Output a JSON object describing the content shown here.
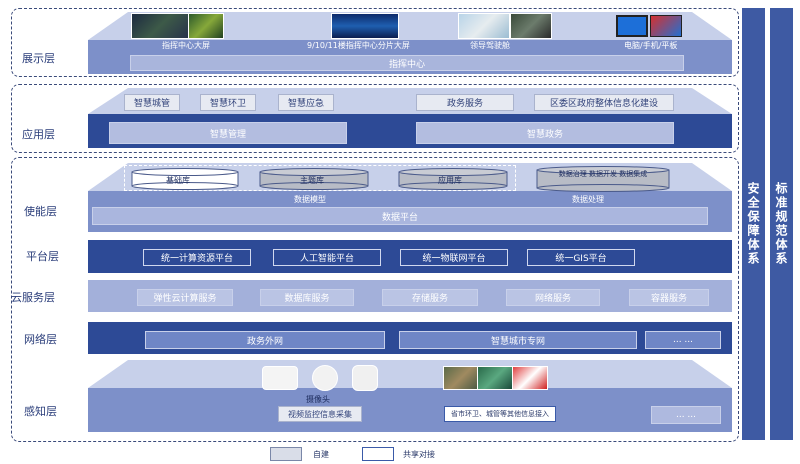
{
  "layers": {
    "display": "展示层",
    "application": "应用层",
    "enablement": "使能层",
    "platform": "平台层",
    "cloud": "云服务层",
    "network": "网络层",
    "perception": "感知层"
  },
  "display": {
    "captions": [
      "指挥中心大屏",
      "9/10/11楼指挥中心分片大屏",
      "领导驾驶舱",
      "电脑/手机/平板"
    ],
    "center": "指挥中心"
  },
  "application": {
    "top_items": [
      "智慧城管",
      "智慧环卫",
      "智慧应急",
      "政务服务",
      "区委区政府整体信息化建设"
    ],
    "bottom_items": [
      "智慧管理",
      "智慧政务"
    ]
  },
  "enablement": {
    "cylinders": [
      "基础库",
      "主题库",
      "应用库",
      "数据治理 数据开发 数据集成"
    ],
    "sub_labels": [
      "数据模型",
      "数据处理"
    ],
    "platform": "数据平台"
  },
  "platform": {
    "items": [
      "统一计算资源平台",
      "人工智能平台",
      "统一物联网平台",
      "统一GIS平台"
    ]
  },
  "cloud": {
    "items": [
      "弹性云计算服务",
      "数据库服务",
      "存储服务",
      "网络服务",
      "容器服务"
    ]
  },
  "network": {
    "items": [
      "政务外网",
      "智慧城市专网",
      "... ..."
    ]
  },
  "perception": {
    "camera_label": "摄像头",
    "video_access": "视频监控信息采集",
    "integration": "省市环卫、城管等其他信息接入",
    "more": "... ..."
  },
  "side": {
    "security": "安全保障体系",
    "standards": "标准规范体系"
  },
  "legend": {
    "self_built": "自建",
    "shared": "共享对接"
  },
  "colors": {
    "dark_blue": "#2d4a96",
    "mid_blue": "#7d90c9",
    "light_blue": "#c7d0ea",
    "box_gray": "#d9dde8"
  }
}
